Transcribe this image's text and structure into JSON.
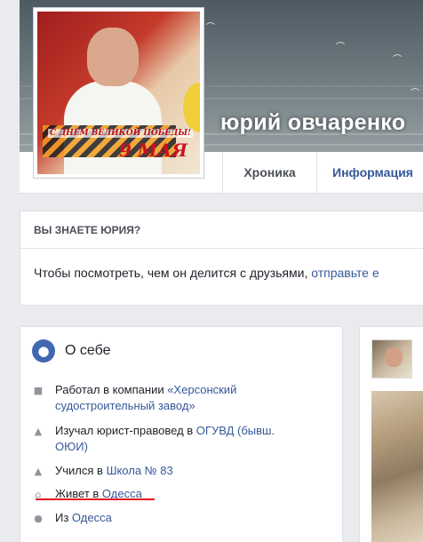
{
  "profile": {
    "name": "юрий овчаренко",
    "avatar_text_line1": "С ДНЕМ ВЕЛИКОЙ ПОБЕДЫ!",
    "avatar_text_line2": "9 МАЯ"
  },
  "tabs": [
    {
      "label": "Хроника"
    },
    {
      "label": "Информация"
    }
  ],
  "know_card": {
    "title": "ВЫ ЗНАЕТЕ ЮРИЯ?",
    "text": "Чтобы посмотреть, чем он делится с друзьями, ",
    "link": "отправьте е"
  },
  "about": {
    "title": "О себе",
    "rows": [
      {
        "icon": "briefcase-icon",
        "prefix": "Работал в компании ",
        "link": "«Херсонский судостроительный завод»"
      },
      {
        "icon": "graduation-cap-icon",
        "prefix": "Изучал юрист-правовед в ",
        "link": "ОГУВД (бывш. ОЮИ)"
      },
      {
        "icon": "graduation-cap-icon",
        "prefix": "Учился в ",
        "link": "Школа № 83"
      },
      {
        "icon": "home-icon",
        "prefix": "Живет в ",
        "link": "Одесса"
      },
      {
        "icon": "location-pin-icon",
        "prefix": "Из ",
        "link": "Одесса"
      }
    ]
  },
  "colors": {
    "link": "#365899",
    "background": "#e9ebee",
    "underline_annotation": "#e4141c",
    "globe": "#4267b2"
  }
}
